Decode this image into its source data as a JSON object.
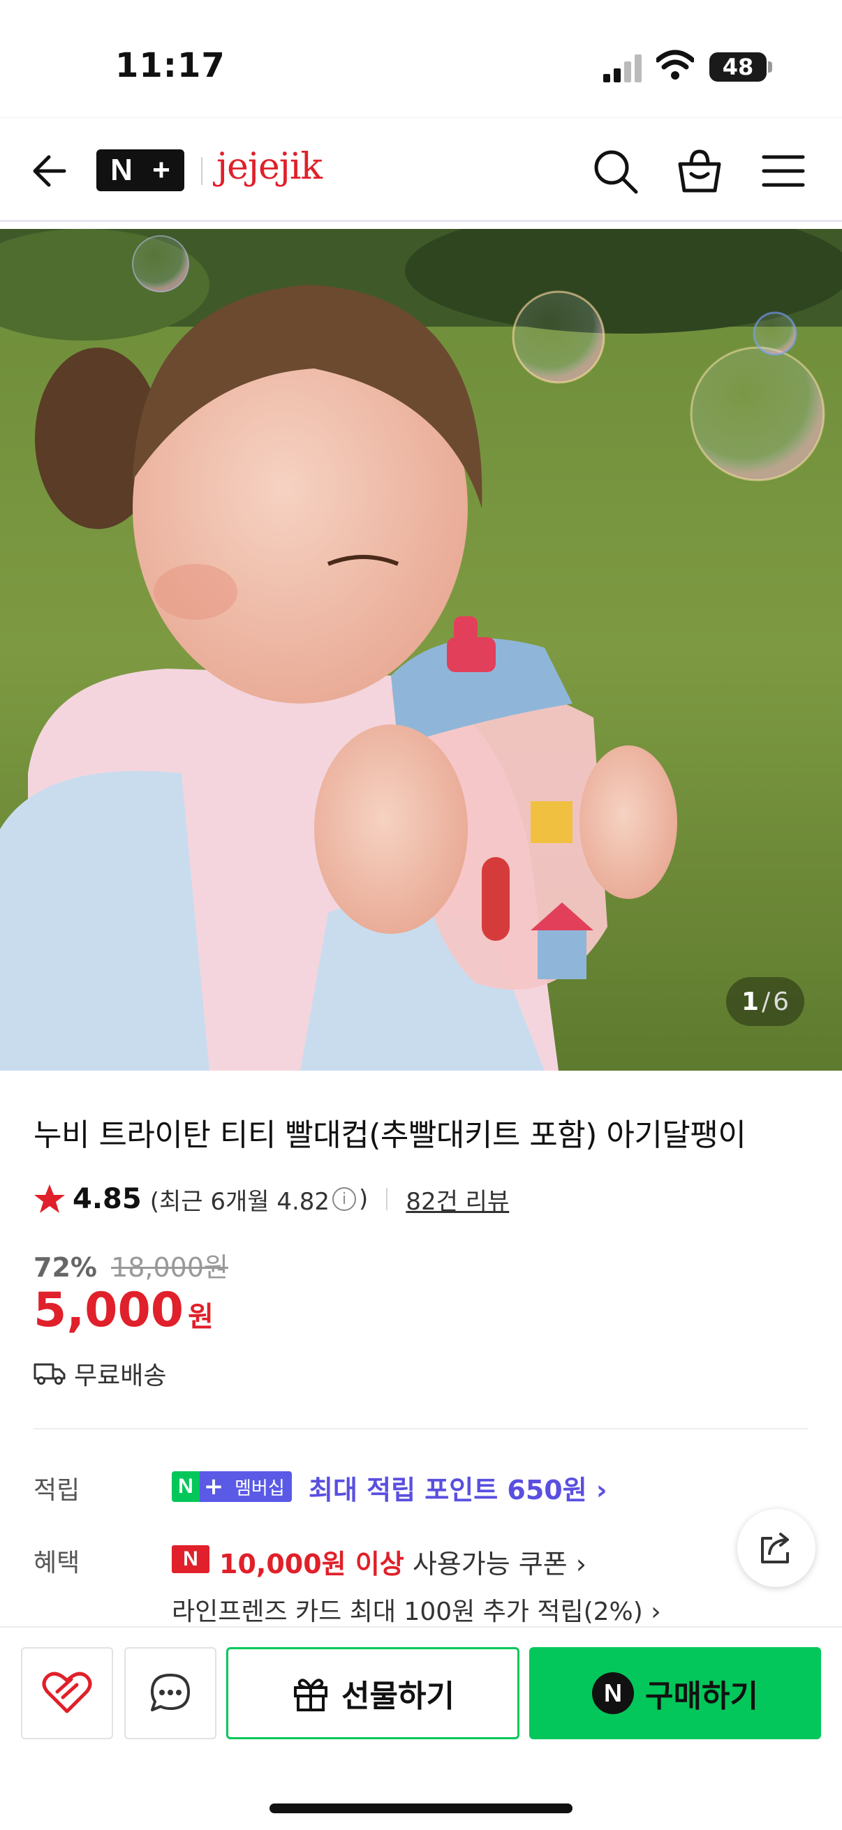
{
  "status_bar": {
    "time": "11:17",
    "battery": "48"
  },
  "header": {
    "logo_left": "N",
    "logo_right": "+",
    "brand": "jejejik"
  },
  "hero": {
    "current": "1",
    "separator": "/",
    "total": "6"
  },
  "product": {
    "title": "누비 트라이탄 티티 빨대컵(추빨대키트 포함) 아기달팽이",
    "rating": "4.85",
    "rating_recent_prefix": "(최근 6개월 4.82",
    "rating_recent_suffix": ")",
    "review_count": "82건 리뷰",
    "discount_rate": "72%",
    "original_price": "18,000원",
    "price": "5,000",
    "price_unit": "원",
    "shipping": "무료배송"
  },
  "benefits": {
    "points_label": "적립",
    "membership_n": "N",
    "membership_plus": "+",
    "membership_text": "멤버십",
    "points_text": "최대 적립 포인트 650원 ›",
    "benefit_label": "혜택",
    "coupon_badge": "N",
    "coupon_strong": "10,000원 이상",
    "coupon_rest": " 사용가능 쿠폰  ›",
    "card_text": "라인프렌즈 카드 최대 100원 추가 적립(2%) ›"
  },
  "bottom_bar": {
    "gift_label": "선물하기",
    "buy_n": "N",
    "buy_label": "구매하기"
  },
  "colors": {
    "naver_green": "#03c75a",
    "price_red": "#e0202a",
    "membership_purple": "#5a4fe0"
  }
}
